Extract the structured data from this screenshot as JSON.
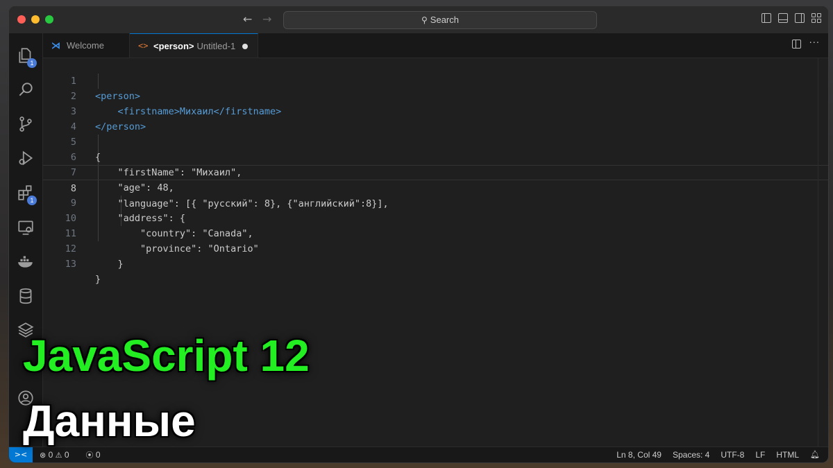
{
  "titlebar": {
    "search_label": "Search",
    "back_icon": "arrow-left-icon",
    "forward_icon": "arrow-right-icon"
  },
  "activity_bar": {
    "items": [
      {
        "icon": "explorer-icon",
        "badge": "1"
      },
      {
        "icon": "search-icon"
      },
      {
        "icon": "source-control-icon"
      },
      {
        "icon": "run-debug-icon"
      },
      {
        "icon": "extensions-icon",
        "badge": "1"
      },
      {
        "icon": "remote-explorer-icon"
      },
      {
        "icon": "docker-icon"
      },
      {
        "icon": "database-icon"
      },
      {
        "icon": "layers-icon"
      },
      {
        "icon": "account-icon"
      }
    ]
  },
  "tabs": [
    {
      "label": "Welcome"
    },
    {
      "label": "<person>",
      "file": "Untitled-1",
      "dirty": true
    }
  ],
  "editor": {
    "active_line": "8",
    "lines": [
      {
        "n": "1",
        "text": "<person>"
      },
      {
        "n": "2",
        "text": "    <firstname>Михаил</firstname>"
      },
      {
        "n": "3",
        "text": "</person>"
      },
      {
        "n": "4",
        "text": ""
      },
      {
        "n": "5",
        "text": "{"
      },
      {
        "n": "6",
        "text": "    \"firstName\": \"Михаил\","
      },
      {
        "n": "7",
        "text": "    \"age\": 48,"
      },
      {
        "n": "8",
        "text": "    \"language\": [{ \"русский\": 8}, {\"английский\":8}],"
      },
      {
        "n": "9",
        "text": "    \"address\": {"
      },
      {
        "n": "10",
        "text": "        \"country\": \"Canada\","
      },
      {
        "n": "11",
        "text": "        \"province\": \"Ontario\""
      },
      {
        "n": "12",
        "text": "    }"
      },
      {
        "n": "13",
        "text": "}"
      }
    ]
  },
  "statusbar": {
    "errors": "0",
    "warnings": "0",
    "ports": "0",
    "position": "Ln 8, Col 49",
    "spaces": "Spaces: 4",
    "encoding": "UTF-8",
    "eol": "LF",
    "language": "HTML"
  },
  "overlay": {
    "title": "JavaScript 12",
    "subtitle": "Данные"
  },
  "colors": {
    "accent": "#0078d4",
    "title_green": "#22ee22",
    "tag_blue": "#569cd6"
  }
}
